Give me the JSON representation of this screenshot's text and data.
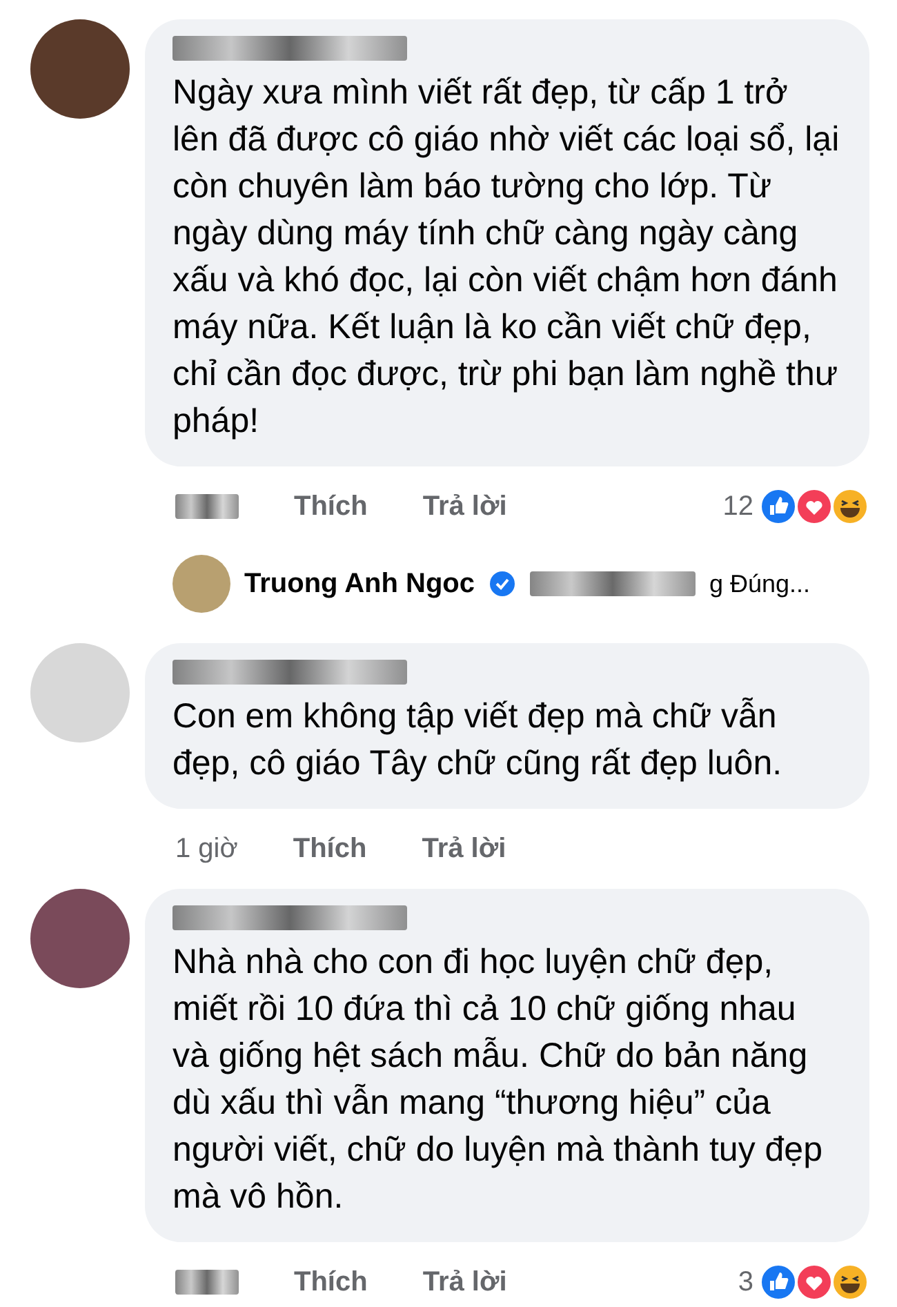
{
  "comments": [
    {
      "text": "Ngày xưa mình viết rất đẹp, từ cấp 1 trở lên đã được cô giáo nhờ viết các loại sổ, lại còn chuyên làm báo tường cho lớp. Từ ngày dùng máy tính chữ càng ngày càng xấu và khó đọc, lại còn viết chậm hơn đánh máy nữa. Kết luận là ko cần viết chữ đẹp, chỉ cần đọc được, trừ phi bạn làm nghề thư pháp!",
      "time_blurred": true,
      "like": "Thích",
      "reply": "Trả lời",
      "reaction_count": "12",
      "reactions": [
        {
          "kind": "like"
        },
        {
          "kind": "love"
        },
        {
          "kind": "haha"
        }
      ],
      "reply_preview": {
        "name": "Truong Anh Ngoc",
        "verified": true,
        "snippet": "g Đúng..."
      }
    },
    {
      "text": "Con em không tập viết đẹp mà chữ vẫn đẹp, cô giáo Tây chữ cũng rất đẹp luôn.",
      "time_blurred": false,
      "time": "1 giờ",
      "like": "Thích",
      "reply": "Trả lời"
    },
    {
      "text": "Nhà nhà cho con đi học luyện chữ đẹp, miết rồi 10 đứa thì cả 10 chữ giống nhau và giống hệt sách mẫu. Chữ do bản năng dù xấu thì vẫn mang “thương hiệu” của người viết, chữ do luyện mà thành tuy đẹp mà vô hồn.",
      "time_blurred": true,
      "like": "Thích",
      "reply": "Trả lời",
      "reaction_count": "3",
      "reactions": [
        {
          "kind": "like"
        },
        {
          "kind": "love"
        },
        {
          "kind": "haha"
        }
      ]
    }
  ]
}
